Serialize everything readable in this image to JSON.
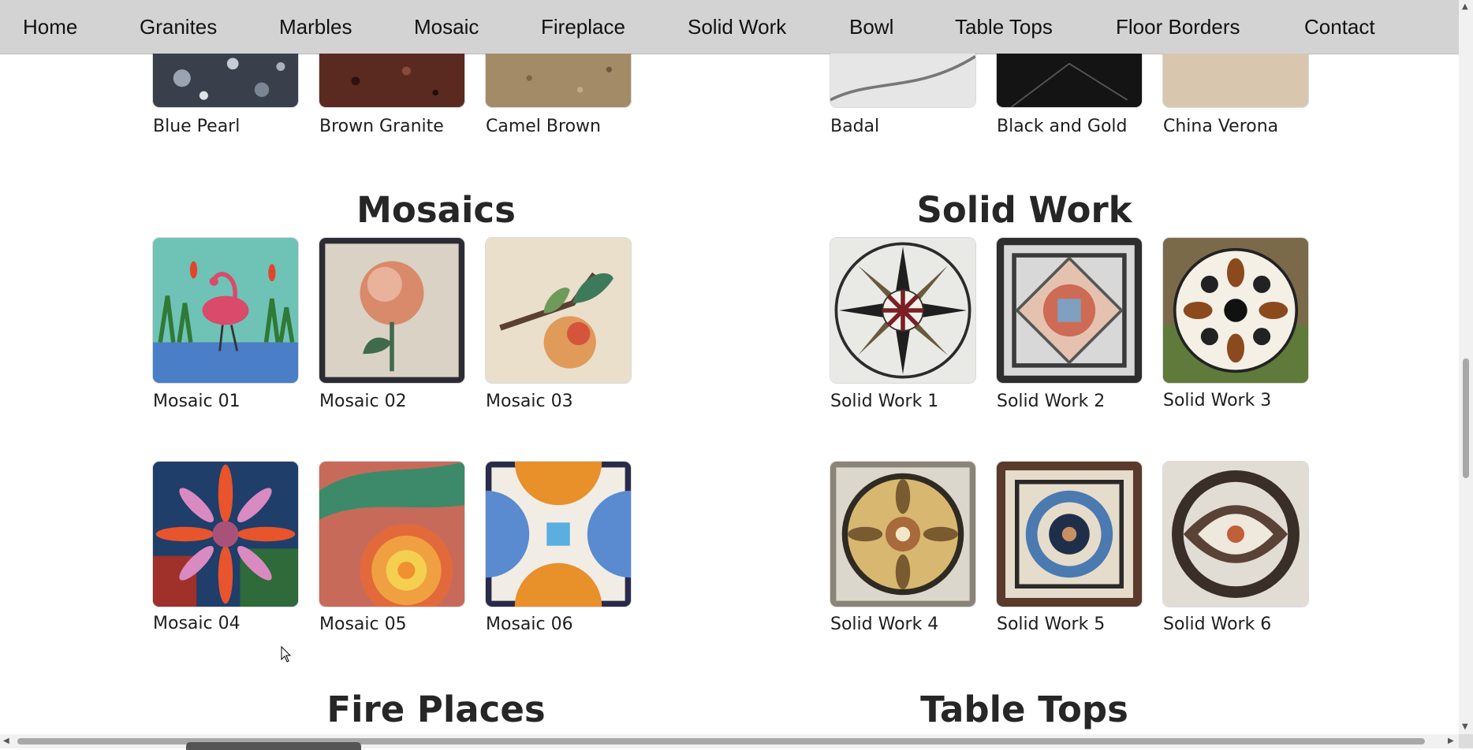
{
  "nav": {
    "items": [
      "Home",
      "Granites",
      "Marbles",
      "Mosaic",
      "Fireplace",
      "Solid Work",
      "Bowl",
      "Table Tops",
      "Floor Borders",
      "Contact"
    ]
  },
  "top_row": {
    "left": [
      "Blue Pearl",
      "Brown Granite",
      "Camel Brown"
    ],
    "right": [
      "Badal",
      "Black and Gold",
      "China Verona"
    ]
  },
  "sections": {
    "mosaics": {
      "title": "Mosaics",
      "items": [
        "Mosaic 01",
        "Mosaic 02",
        "Mosaic 03",
        "Mosaic 04",
        "Mosaic 05",
        "Mosaic 06"
      ]
    },
    "solid_work": {
      "title": "Solid Work",
      "items": [
        "Solid Work 1",
        "Solid Work 2",
        "Solid Work 3",
        "Solid Work 4",
        "Solid Work 5",
        "Solid Work 6"
      ]
    },
    "fire_places": {
      "title": "Fire Places"
    },
    "table_tops": {
      "title": "Table Tops"
    }
  },
  "colors": {
    "nav_bg": "#d3d3d3",
    "heading": "#262626"
  }
}
